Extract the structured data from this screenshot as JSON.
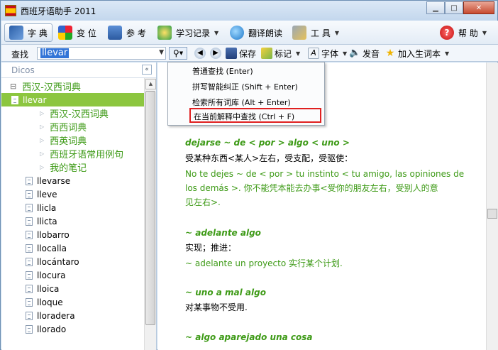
{
  "window": {
    "title": "西班牙语助手 2011"
  },
  "toolbar_main": {
    "tab_dictionary": "字 典",
    "tab_conjugation": "变 位",
    "tab_reference": "参 考",
    "study_record": "学习记录",
    "translate_read": "翻译朗读",
    "tools": "工 具",
    "help": "帮 助"
  },
  "search": {
    "label": "查找",
    "value": "llevar"
  },
  "toolbar_secondary": {
    "save": "保存",
    "mark": "标记",
    "font": "字体",
    "pronounce": "发音",
    "add_vocab": "加入生词本"
  },
  "left_panel": {
    "header": "Dicos"
  },
  "tree": {
    "root": "西汉-汉西词典",
    "selected": "llevar",
    "sub_dicts": [
      "西汉-汉西词典",
      "西西词典",
      "西英词典",
      "西班牙语常用例句",
      "我的笔记"
    ],
    "words": [
      "llevarse",
      "lleve",
      "llicla",
      "llicta",
      "llobarro",
      "llocalla",
      "llocántaro",
      "llocura",
      "lloica",
      "lloque",
      "lloradera",
      "llorado"
    ]
  },
  "search_menu": {
    "items": [
      "普通查找 (Enter)",
      "拼写智能纠正 (Shift + Enter)",
      "检索所有词库 (Alt + Enter)",
      "在当前解释中查找 (Ctrl + F)"
    ]
  },
  "entries": [
    {
      "headword": "dejarse ~ de < por > algo < uno >",
      "meaning": "受某种东西<某人>左右，受支配，受驱使：",
      "example_lines": [
        "No te dejes ~ de < por > tu instinto < tu amigo, las opiniones de",
        "los demás >. 你不能凭本能去办事<受你的朋友左右，受别人的意",
        "见左右>."
      ]
    },
    {
      "headword": "~ adelante algo",
      "meaning": "实现；推进：",
      "example_lines": [
        "~ adelante un proyecto 实行某个计划."
      ]
    },
    {
      "headword": "~ uno a mal algo",
      "meaning": "对某事物不受用.",
      "example_lines": []
    },
    {
      "headword": "~ algo aparejado una cosa",
      "meaning": "",
      "example_lines": []
    }
  ],
  "colors": {
    "accent_green": "#3d9a16",
    "selection_green": "#8cc63f",
    "highlight_red": "#e02020"
  }
}
